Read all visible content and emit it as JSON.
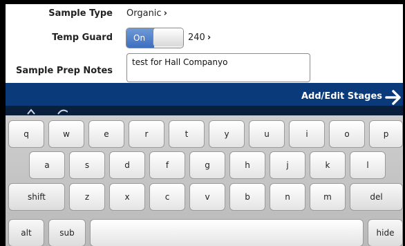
{
  "form": {
    "sample_type_label": "Sample Type",
    "sample_type_value": "Organic",
    "temp_guard_label": "Temp Guard",
    "temp_guard_toggle": "On",
    "temp_guard_value": "240",
    "notes_label": "Sample Prep Notes",
    "notes_value": "test for Hall Companyo"
  },
  "stage_bar": {
    "link_label": "Add/Edit Stages",
    "arrow_icon": "arrow-right-icon",
    "background": "#0b3a7a"
  },
  "keyboard": {
    "row1": [
      "q",
      "w",
      "e",
      "r",
      "t",
      "y",
      "u",
      "i",
      "o",
      "p"
    ],
    "row2": [
      "a",
      "s",
      "d",
      "f",
      "g",
      "h",
      "j",
      "k",
      "l"
    ],
    "row3": [
      "shift",
      "z",
      "x",
      "c",
      "v",
      "b",
      "n",
      "m",
      "del"
    ],
    "row4": [
      "alt",
      "sub",
      "",
      "hide"
    ]
  }
}
